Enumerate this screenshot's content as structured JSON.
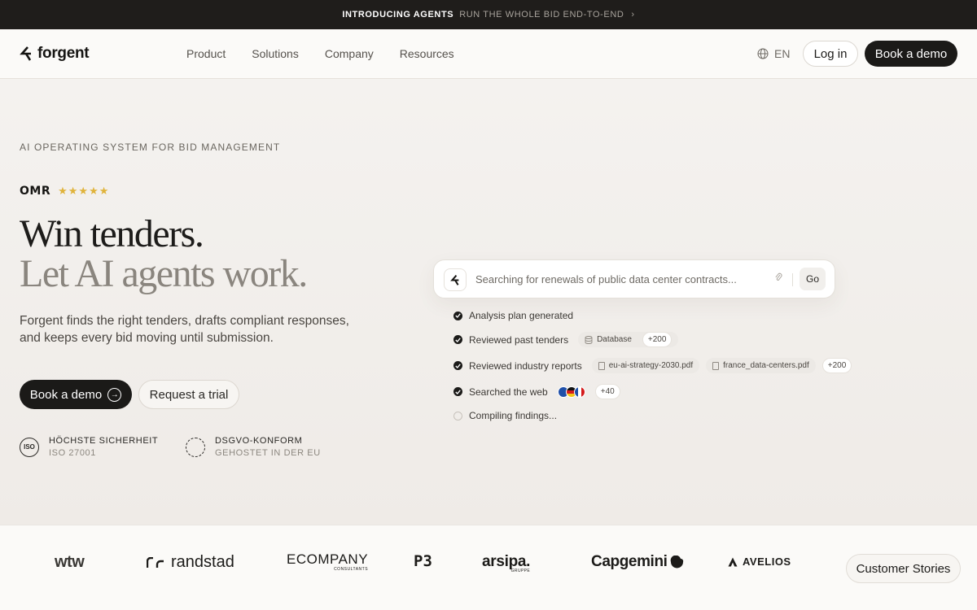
{
  "announcement": {
    "label": "INTRODUCING AGENTS",
    "text": "RUN THE WHOLE BID END-TO-END",
    "chevron": "›"
  },
  "nav": {
    "logo": "forgent",
    "links": [
      "Product",
      "Solutions",
      "Company",
      "Resources"
    ],
    "language": "EN",
    "login": "Log in",
    "demo": "Book a demo"
  },
  "hero": {
    "eyebrow": "AI OPERATING SYSTEM FOR BID MANAGEMENT",
    "rating_brand": "OMR",
    "rating_stars": 5,
    "stars": "★★★★★",
    "headline_1": "Win tenders.",
    "headline_2": "Let AI agents work.",
    "subtitle": "Forgent finds the right tenders, drafts compliant responses, and keeps every bid moving until submission.",
    "cta_primary": "Book a demo",
    "cta_secondary": "Request a trial",
    "badges": [
      {
        "title": "HÖCHSTE SICHERHEIT",
        "subtitle": "ISO 27001",
        "icon": "ISO"
      },
      {
        "title": "DSGVO-KONFORM",
        "subtitle": "GEHOSTET IN DER EU"
      }
    ]
  },
  "agent": {
    "query": "Searching for renewals of public data center contracts...",
    "go": "Go",
    "steps": [
      {
        "label": "Analysis plan generated",
        "status": "done"
      },
      {
        "label": "Reviewed past tenders",
        "status": "done",
        "chips": [
          "Database"
        ],
        "more": "+200"
      },
      {
        "label": "Reviewed industry reports",
        "status": "done",
        "chips": [
          "eu-ai-strategy-2030.pdf",
          "france_data-centers.pdf"
        ],
        "more": "+200"
      },
      {
        "label": "Searched the web",
        "status": "done",
        "more": "+40"
      },
      {
        "label": "Compiling findings...",
        "status": "pending"
      }
    ]
  },
  "logos": {
    "items": [
      "wtw",
      "randstad",
      "ECOMPANY",
      "CONSULTANTS",
      "P3",
      "arsipa.",
      "GRUPPE",
      "Capgemini",
      "AVELIOS"
    ],
    "stories": "Customer Stories"
  }
}
